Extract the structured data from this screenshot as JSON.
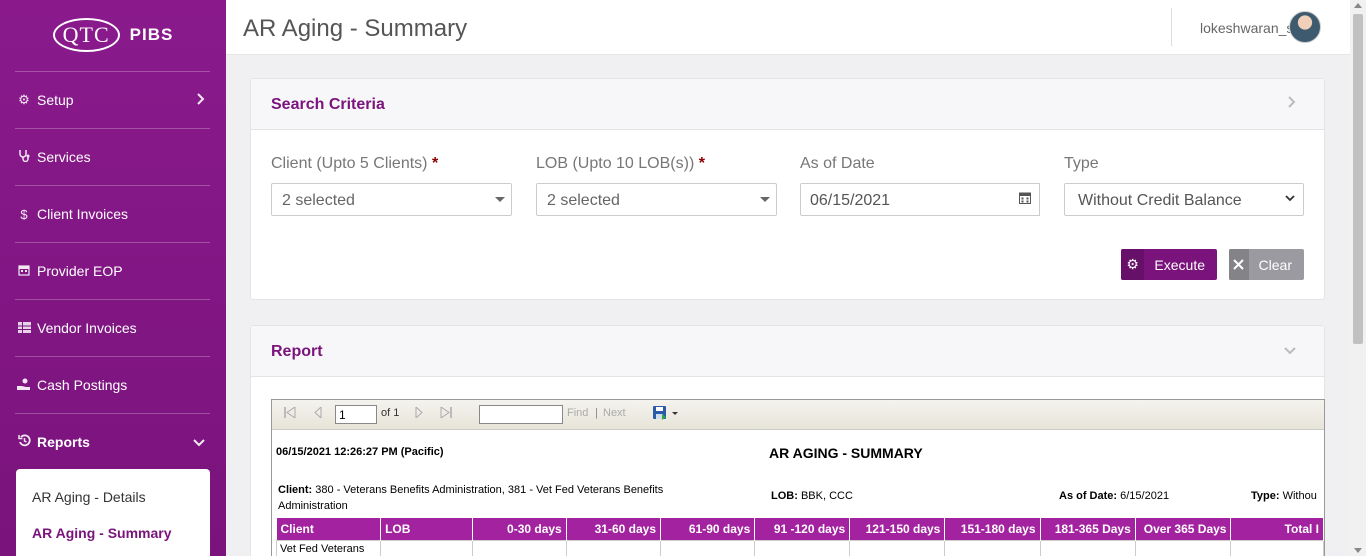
{
  "app": {
    "logo_text": "QTC",
    "product": "PIBS"
  },
  "header": {
    "title": "AR Aging - Summary",
    "username": "lokeshwaran_s"
  },
  "sidebar": {
    "items": [
      {
        "label": "Setup",
        "icon": "gear-icon"
      },
      {
        "label": "Services",
        "icon": "stethoscope-icon"
      },
      {
        "label": "Client Invoices",
        "icon": "dollar-icon"
      },
      {
        "label": "Provider EOP",
        "icon": "calendar-icon"
      },
      {
        "label": "Vendor Invoices",
        "icon": "table-icon"
      },
      {
        "label": "Cash Postings",
        "icon": "hand-money-icon"
      },
      {
        "label": "Reports",
        "icon": "history-icon"
      }
    ],
    "submenu": [
      {
        "label": "AR Aging - Details"
      },
      {
        "label": "AR Aging - Summary"
      }
    ]
  },
  "search": {
    "title": "Search Criteria",
    "client_label": "Client (Upto 5 Clients)",
    "client_value": "2 selected",
    "lob_label": "LOB (Upto 10 LOB(s))",
    "lob_value": "2 selected",
    "date_label": "As of Date",
    "date_value": "06/15/2021",
    "type_label": "Type",
    "type_value": "Without Credit Balance",
    "required_mark": "*",
    "execute_label": "Execute",
    "clear_label": "Clear"
  },
  "report": {
    "title": "Report",
    "toolbar": {
      "page_value": "1",
      "of_label": "of 1",
      "find_label": "Find",
      "sep": "|",
      "next_label": "Next"
    },
    "timestamp": "06/15/2021 12:26:27 PM (Pacific)",
    "heading": "AR AGING - SUMMARY",
    "client_label": "Client:",
    "client_value": "380 - Veterans Benefits Administration, 381 - Vet Fed Veterans Benefits Administration",
    "lob_label": "LOB:",
    "lob_value": "BBK, CCC",
    "asof_label": "As of Date:",
    "asof_value": "6/15/2021",
    "type_label": "Type:",
    "type_value": "Withou",
    "columns": [
      "Client",
      "LOB",
      "0-30 days",
      "31-60 days",
      "61-90 days",
      "91 -120 days",
      "121-150 days",
      "151-180 days",
      "181-365 Days",
      "Over 365 Days",
      "Total I"
    ],
    "first_row_client": "Vet Fed Veterans"
  },
  "colors": {
    "brand": "#7a137c",
    "header_row": "#a3229f",
    "clear_btn": "#9a9aa0"
  }
}
